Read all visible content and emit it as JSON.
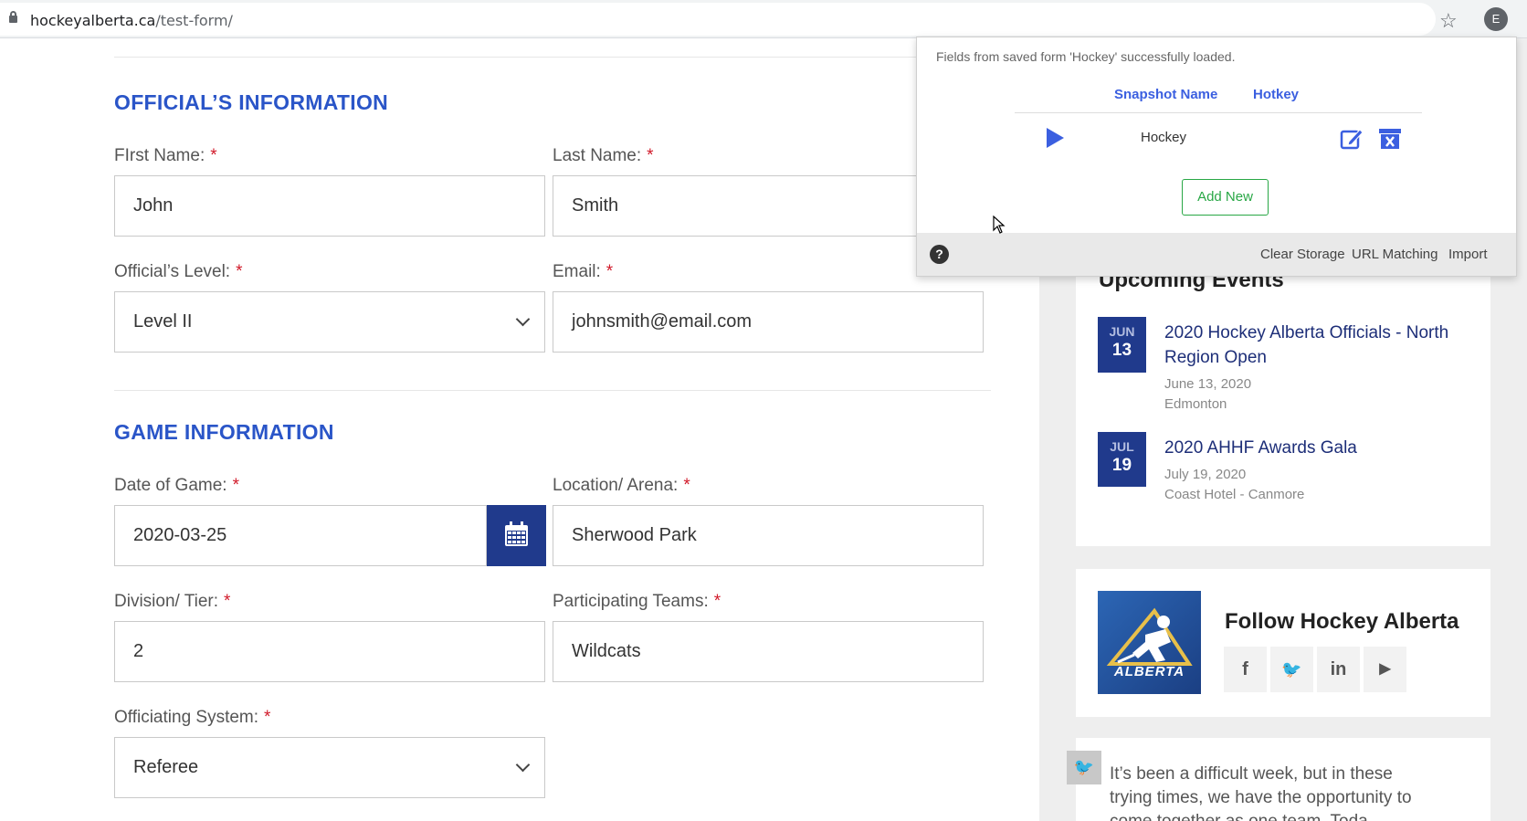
{
  "browser": {
    "url_domain": "hockeyalberta.ca",
    "url_path": "/test-form/",
    "profile_initial": "E"
  },
  "form": {
    "officials_section_title": "OFFICIAL’S INFORMATION",
    "game_section_title": "GAME INFORMATION",
    "required_mark": "*",
    "fields": {
      "first_name": {
        "label": "FIrst Name:",
        "value": "John"
      },
      "last_name": {
        "label": "Last Name:",
        "value": "Smith"
      },
      "level": {
        "label": "Official’s Level:",
        "value": "Level II"
      },
      "email": {
        "label": "Email:",
        "value": "johnsmith@email.com"
      },
      "date": {
        "label": "Date of Game:",
        "value": "2020-03-25"
      },
      "location": {
        "label": "Location/ Arena:",
        "value": "Sherwood Park"
      },
      "division": {
        "label": "Division/ Tier:",
        "value": "2"
      },
      "teams": {
        "label": "Participating Teams:",
        "value": "Wildcats"
      },
      "system": {
        "label": "Officiating System:",
        "value": "Referee"
      }
    }
  },
  "sidebar": {
    "events_title": "Upcoming Events",
    "events": [
      {
        "month": "JUN",
        "day": "13",
        "title": "2020 Hockey Alberta Officials - North Region Open",
        "date": "June 13, 2020",
        "place": "Edmonton"
      },
      {
        "month": "JUL",
        "day": "19",
        "title": "2020 AHHF Awards Gala",
        "date": "July 19, 2020",
        "place": "Coast Hotel - Canmore"
      }
    ],
    "follow_title": "Follow Hockey Alberta",
    "logo_text": "ALBERTA",
    "social": [
      "f",
      "🐦",
      "in",
      "▶"
    ],
    "tweet_text": "It’s been a difficult week, but in these trying times, we have the opportunity to come together as one team. Toda"
  },
  "popup": {
    "message": "Fields from saved form 'Hockey' successfully loaded.",
    "col_snapshot": "Snapshot Name",
    "col_hotkey": "Hotkey",
    "snapshot_name": "Hockey",
    "add_new": "Add New",
    "help": "?",
    "footer_links": [
      "Clear Storage",
      "URL Matching",
      "Import"
    ]
  },
  "colors": {
    "brand_blue": "#203a8c",
    "heading_blue": "#2a55c8",
    "required_red": "#d11a2a",
    "extension_blue": "#3b5fe0",
    "add_green": "#28a745"
  }
}
